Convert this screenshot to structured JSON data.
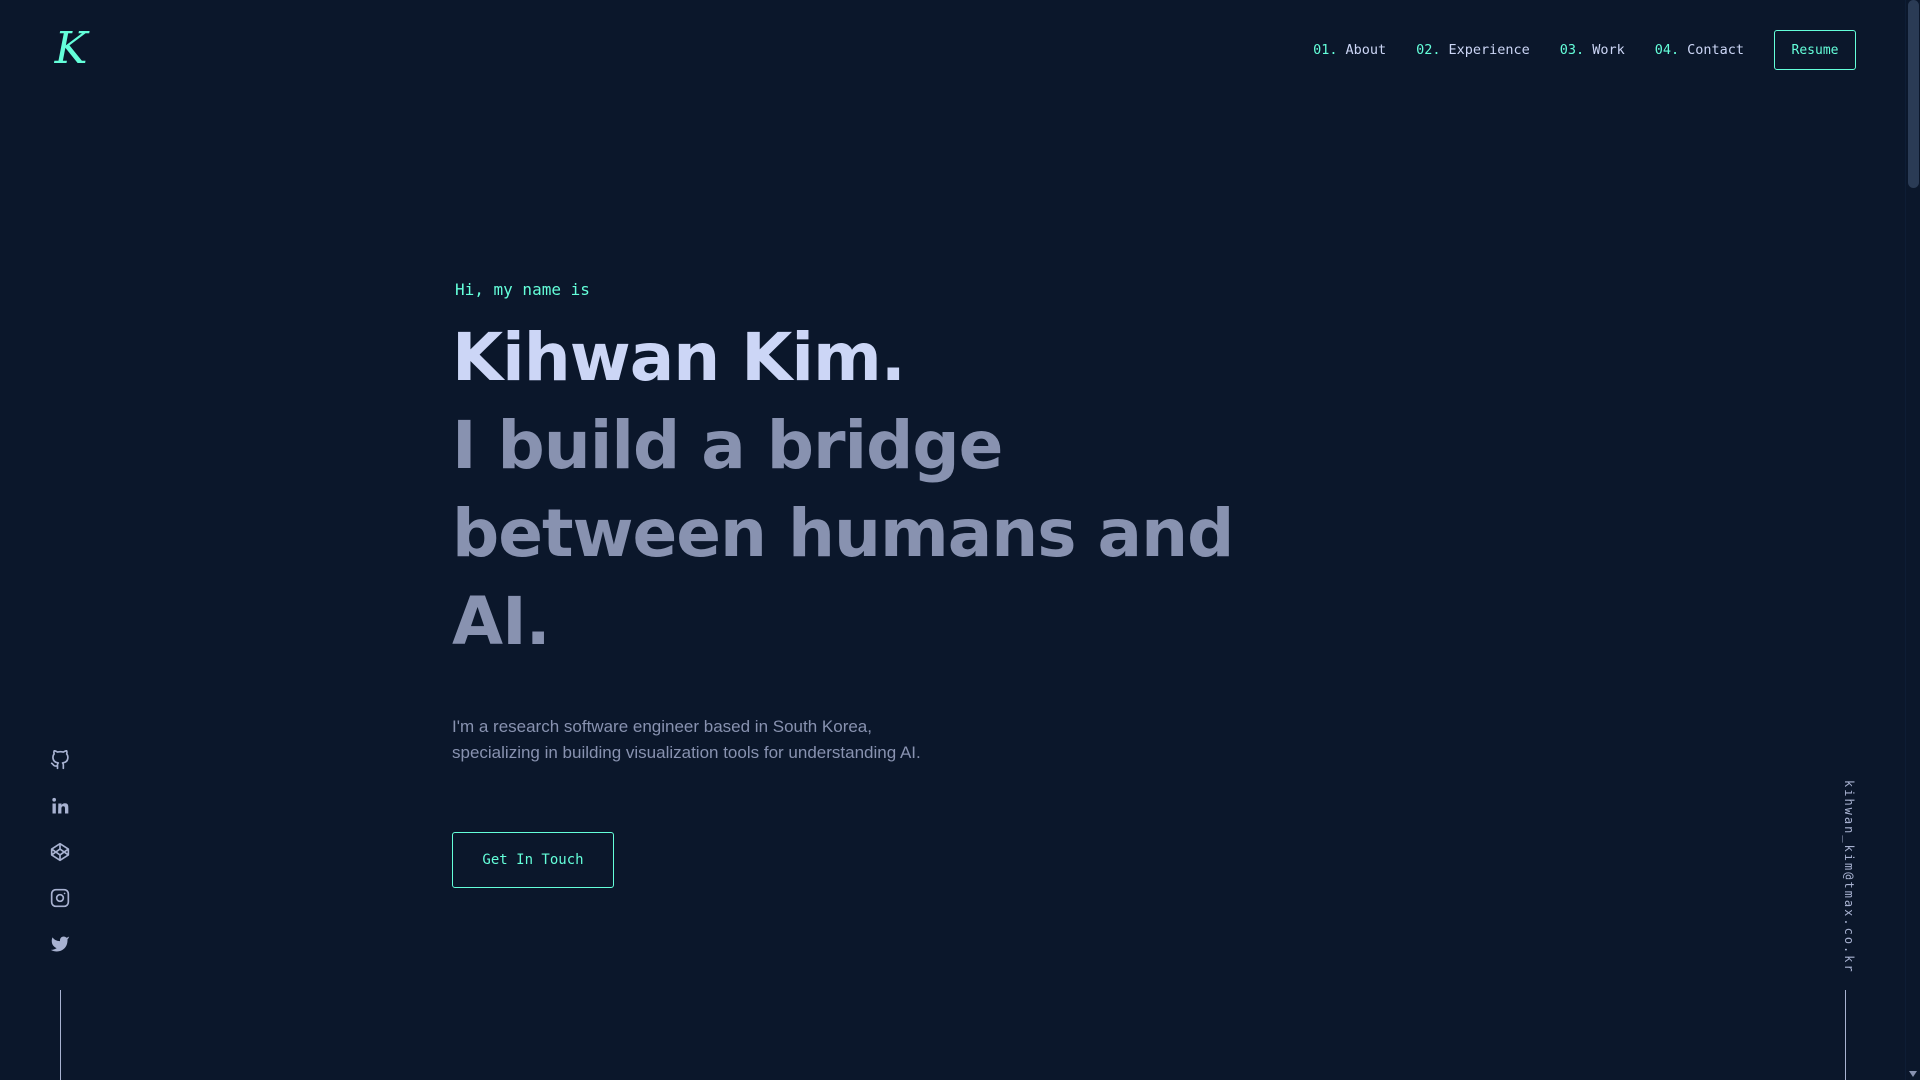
{
  "logo": {
    "letter": "K"
  },
  "nav": {
    "items": [
      {
        "num": "01.",
        "label": "About"
      },
      {
        "num": "02.",
        "label": "Experience"
      },
      {
        "num": "03.",
        "label": "Work"
      },
      {
        "num": "04.",
        "label": "Contact"
      }
    ],
    "resume_label": "Resume"
  },
  "hero": {
    "greeting": "Hi, my name is",
    "name": "Kihwan Kim.",
    "tagline": "I build a bridge between humans and AI.",
    "intro_line1": "I'm a research software engineer based in South Korea,",
    "intro_line2": "specializing in building visualization tools for understanding AI.",
    "cta_label": "Get In Touch"
  },
  "social": {
    "icons": [
      "github-icon",
      "linkedin-icon",
      "codepen-icon",
      "instagram-icon",
      "twitter-icon"
    ]
  },
  "email": "kihwan_kim@tmax.co.kr",
  "colors": {
    "background": "#0b172b",
    "accent": "#64ffda",
    "heading": "#ccd6f6",
    "muted": "#8892b0"
  }
}
